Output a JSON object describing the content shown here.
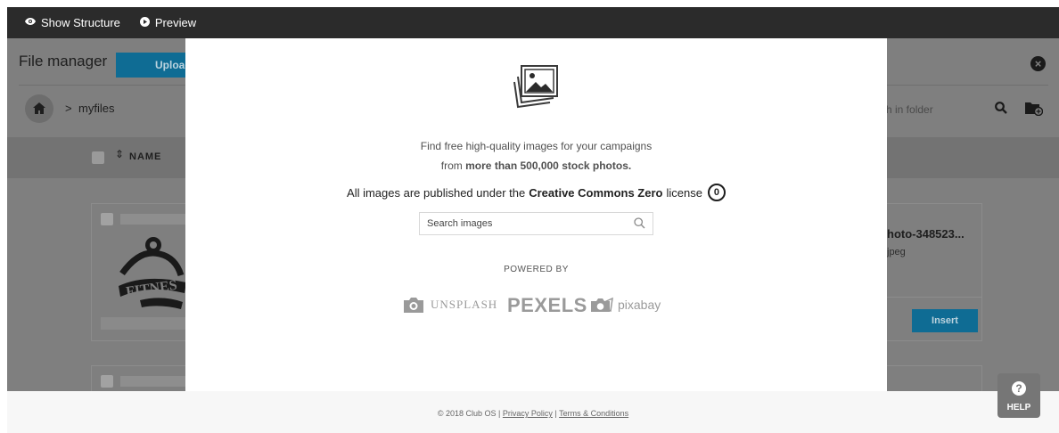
{
  "toolbar": {
    "show_structure_icon": "eye-icon",
    "show_structure_label": "Show Structure",
    "preview_icon": "play-circle-icon",
    "preview_label": "Preview"
  },
  "file_manager": {
    "title": "File manager",
    "upload_label": "Upload",
    "breadcrumb": {
      "home_icon": "home-icon",
      "separator": ">",
      "current": "myfiles"
    },
    "search_placeholder": "h in folder",
    "columns": {
      "name": "NAME"
    },
    "files": [
      {
        "name": "hoto-348523...",
        "ext": "jpeg",
        "insert_label": "Insert"
      }
    ]
  },
  "modal": {
    "line1": "Find free high-quality images for your campaigns",
    "line2_prefix": "from",
    "line2_bold": "more than 500,000 stock photos.",
    "line3_prefix": "All images are published under the",
    "line3_bold": "Creative Commons Zero",
    "line3_suffix": "license",
    "cc_badge": "0",
    "search_placeholder": "Search images",
    "powered_by": "POWERED BY",
    "providers": [
      "UNSPLASH",
      "PEXELS",
      "pixabay"
    ]
  },
  "footer": {
    "copyright": "© 2018 Club OS |",
    "privacy": "Privacy Policy",
    "sep": "|",
    "terms": "Terms & Conditions"
  },
  "help": {
    "label": "HELP",
    "icon": "question-icon"
  },
  "colors": {
    "toolbar_bg": "#2b2b2b",
    "accent": "#0f6c94",
    "overlay": "#7f7f7f",
    "modal_bg": "#ffffff"
  }
}
